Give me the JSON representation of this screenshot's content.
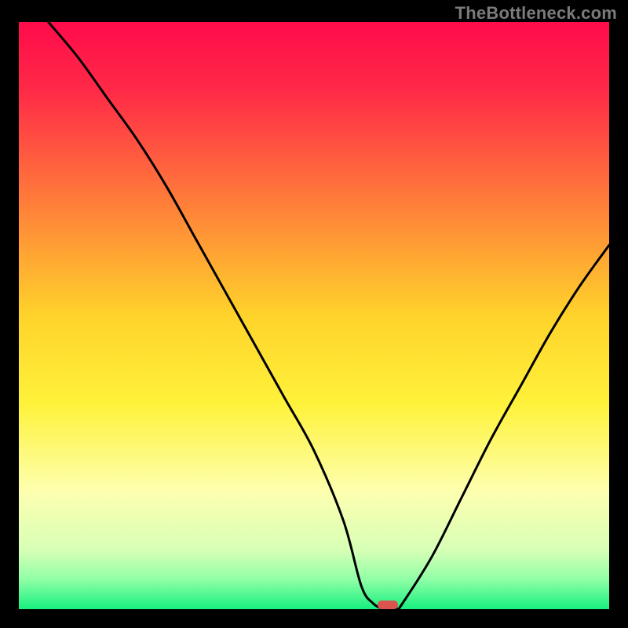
{
  "watermark": "TheBottleneck.com",
  "chart_data": {
    "type": "line",
    "title": "",
    "xlabel": "",
    "ylabel": "",
    "xlim": [
      0,
      100
    ],
    "ylim": [
      0,
      100
    ],
    "grid": false,
    "series": [
      {
        "name": "bottleneck-curve",
        "x": [
          5,
          10,
          15,
          20,
          25,
          30,
          35,
          40,
          45,
          50,
          55,
          58,
          60,
          62,
          64,
          65,
          70,
          75,
          80,
          85,
          90,
          95,
          100
        ],
        "values": [
          100,
          94,
          87,
          80,
          72,
          63,
          54,
          45,
          36,
          27,
          15,
          4,
          1,
          0,
          0,
          1,
          9,
          19,
          29,
          38,
          47,
          55,
          62
        ]
      }
    ],
    "marker": {
      "x": 62.5,
      "y": 0.8,
      "color": "#d9534f"
    },
    "gradient_stops": [
      {
        "offset": 0,
        "color": "#ff0b4b"
      },
      {
        "offset": 0.12,
        "color": "#ff2b47"
      },
      {
        "offset": 0.3,
        "color": "#ff7a3a"
      },
      {
        "offset": 0.5,
        "color": "#ffd32b"
      },
      {
        "offset": 0.65,
        "color": "#fff23a"
      },
      {
        "offset": 0.8,
        "color": "#fdffb0"
      },
      {
        "offset": 0.9,
        "color": "#d7ffb6"
      },
      {
        "offset": 0.95,
        "color": "#8fffa6"
      },
      {
        "offset": 1.0,
        "color": "#17f07f"
      }
    ],
    "annotations": []
  }
}
